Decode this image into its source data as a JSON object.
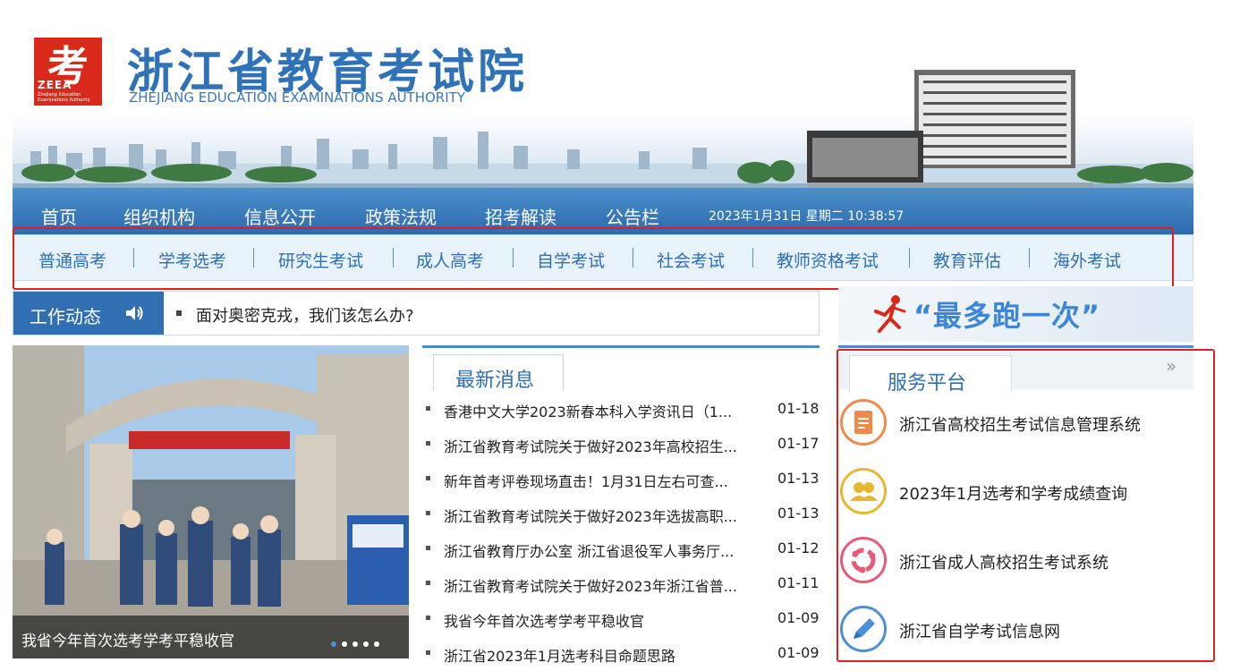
{
  "header": {
    "logo_glyph": "考",
    "logo_abbr": "ZEEA",
    "logo_subtext": "Zhejiang Education Examinations Authority",
    "title": "浙江省教育考试院",
    "subtitle": "ZHEJIANG EDUCATION EXAMINATIONS AUTHORITY"
  },
  "main_nav": {
    "items": [
      "首页",
      "组织机构",
      "信息公开",
      "政策法规",
      "招考解读",
      "公告栏"
    ],
    "datetime": "2023年1月31日 星期二 10:38:57"
  },
  "sub_nav": {
    "items": [
      "普通高考",
      "学考选考",
      "研究生考试",
      "成人高考",
      "自学考试",
      "社会考试",
      "教师资格考试",
      "教育评估",
      "海外考试"
    ]
  },
  "work_news": {
    "label": "工作动态",
    "icon": "speaker-icon",
    "headline": "面对奥密克戎，我们该怎么办?"
  },
  "slideshow": {
    "caption": "我省今年首次选考学考平稳收官",
    "dot_count": 5,
    "active_dot": 0
  },
  "latest_news": {
    "tab_label": "最新消息",
    "items": [
      {
        "title": "香港中文大学2023新春本科入学资讯日（1...",
        "date": "01-18"
      },
      {
        "title": "浙江省教育考试院关于做好2023年高校招生...",
        "date": "01-17"
      },
      {
        "title": "新年首考评卷现场直击！1月31日左右可查...",
        "date": "01-13"
      },
      {
        "title": "浙江省教育考试院关于做好2023年选拔高职...",
        "date": "01-13"
      },
      {
        "title": "浙江省教育厅办公室 浙江省退役军人事务厅...",
        "date": "01-12"
      },
      {
        "title": "浙江省教育考试院关于做好2023年浙江省普...",
        "date": "01-11"
      },
      {
        "title": "我省今年首次选考学考平稳收官",
        "date": "01-09"
      },
      {
        "title": "浙江省2023年1月选考科目命题思路",
        "date": "01-09"
      }
    ]
  },
  "promo": {
    "slogan": "“最多跑一次”",
    "icon": "runner-icon"
  },
  "service_platform": {
    "tab_label": "服务平台",
    "more_glyph": "»",
    "items": [
      {
        "label": "浙江省高校招生考试信息管理系统",
        "icon": "document-icon",
        "color": "#f08a4b"
      },
      {
        "label": "2023年1月选考和学考成绩查询",
        "icon": "users-icon",
        "color": "#e6b830"
      },
      {
        "label": "浙江省成人高校招生考试系统",
        "icon": "cycle-icon",
        "color": "#e65a7a"
      },
      {
        "label": "浙江省自学考试信息网",
        "icon": "pen-icon",
        "color": "#4a90d9"
      }
    ]
  },
  "colors": {
    "brand_blue": "#2f6fb2",
    "logo_red": "#d8291b",
    "highlight_red": "#e02020"
  }
}
